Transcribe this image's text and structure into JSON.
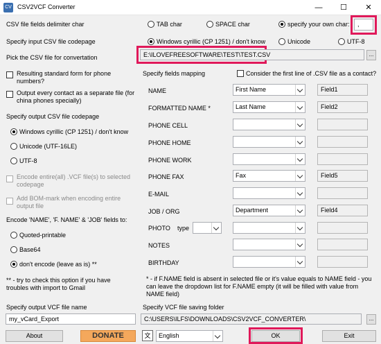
{
  "window": {
    "title": "CSV2VCF Converter",
    "app_icon": "csv2vcf-icon",
    "minimize": "—",
    "maximize": "☐",
    "close": "✕"
  },
  "delimiter": {
    "label": "CSV file fields delimiter char",
    "options": [
      "TAB char",
      "SPACE char",
      "specify your own char:"
    ],
    "selected": "specify your own char:",
    "own_char_value": ","
  },
  "input_codepage": {
    "label": "Specify input CSV file codepage",
    "options": [
      "Windows cyrillic (CP 1251) / don't know",
      "Unicode",
      "UTF-8"
    ],
    "selected": "Windows cyrillic (CP 1251) / don't know"
  },
  "csv_file": {
    "label": "Pick the CSV file for convertation",
    "path": "E:\\ILOVEFREESOFTWARE\\TEST\\TEST.CSV",
    "browse": "..."
  },
  "phone_standard": {
    "label": "Resulting standard form for phone numbers?",
    "checked": false
  },
  "separate_file": {
    "label": "Output every contact as a separate file (for china phones specially)",
    "checked": false
  },
  "output_codepage": {
    "label": "Specify output CSV file codepage",
    "options": [
      "Windows cyrillic (CP 1251) / don't know",
      "Unicode (UTF-16LE)",
      "UTF-8"
    ],
    "selected": "Windows cyrillic (CP 1251) / don't know"
  },
  "encode_entire": {
    "label": "Encode entire(all) .VCF file(s) to selected codepage",
    "checked": false,
    "disabled": true
  },
  "bom_mark": {
    "label": "Add BOM-mark when encoding entire output file",
    "checked": false,
    "disabled": true
  },
  "encode_fields": {
    "label": "Encode 'NAME', 'F. NAME' & 'JOB' fields to:",
    "options": [
      "Quoted-printable",
      "Base64",
      "don't encode (leave as is) **"
    ],
    "selected": "don't encode (leave as is) **"
  },
  "note_left": "** - try to check this option if you have troubles with import to Gmail",
  "mapping": {
    "label": "Specify fields mapping",
    "first_line_label": "Consider the first line of .CSV file as a contact?",
    "first_line_checked": false,
    "rows": [
      {
        "name": "NAME",
        "value": "First Name",
        "field": "Field1"
      },
      {
        "name": "FORMATTED NAME *",
        "value": "Last Name",
        "field": "Field2"
      },
      {
        "name": "PHONE CELL",
        "value": "",
        "field": ""
      },
      {
        "name": "PHONE HOME",
        "value": "",
        "field": ""
      },
      {
        "name": "PHONE WORK",
        "value": "",
        "field": ""
      },
      {
        "name": "PHONE FAX",
        "value": "Fax",
        "field": "Field5"
      },
      {
        "name": "E-MAIL",
        "value": "",
        "field": ""
      },
      {
        "name": "JOB / ORG",
        "value": "Department",
        "field": "Field4"
      },
      {
        "name": "PHOTO",
        "type_label": "type",
        "type_value": "",
        "value": "",
        "field": ""
      },
      {
        "name": "NOTES",
        "value": "",
        "field": ""
      },
      {
        "name": "BIRTHDAY",
        "value": "",
        "field": ""
      }
    ]
  },
  "note_right": "* - if F.NAME field is absent in selected file or it's value equals to NAME field - you can leave the dropdown list for F.NAME empty (it will be filled with value from NAME field)",
  "vcf_name": {
    "label": "Specify output VCF file name",
    "value": "my_vCard_Export"
  },
  "vcf_folder": {
    "label": "Specify VCF file saving folder",
    "path": "C:\\USERS\\ILFS\\DOWNLOADS\\CSV2VCF_CONVERTER\\",
    "browse": "..."
  },
  "footer": {
    "about": "About",
    "donate": "DONATE",
    "language_icon": "translate-icon",
    "language": "English",
    "ok": "OK",
    "exit": "Exit"
  },
  "colors": {
    "highlight": "#e0195a",
    "donate_bg": "#f4a85c",
    "window_bg": "#f0f0f0"
  }
}
